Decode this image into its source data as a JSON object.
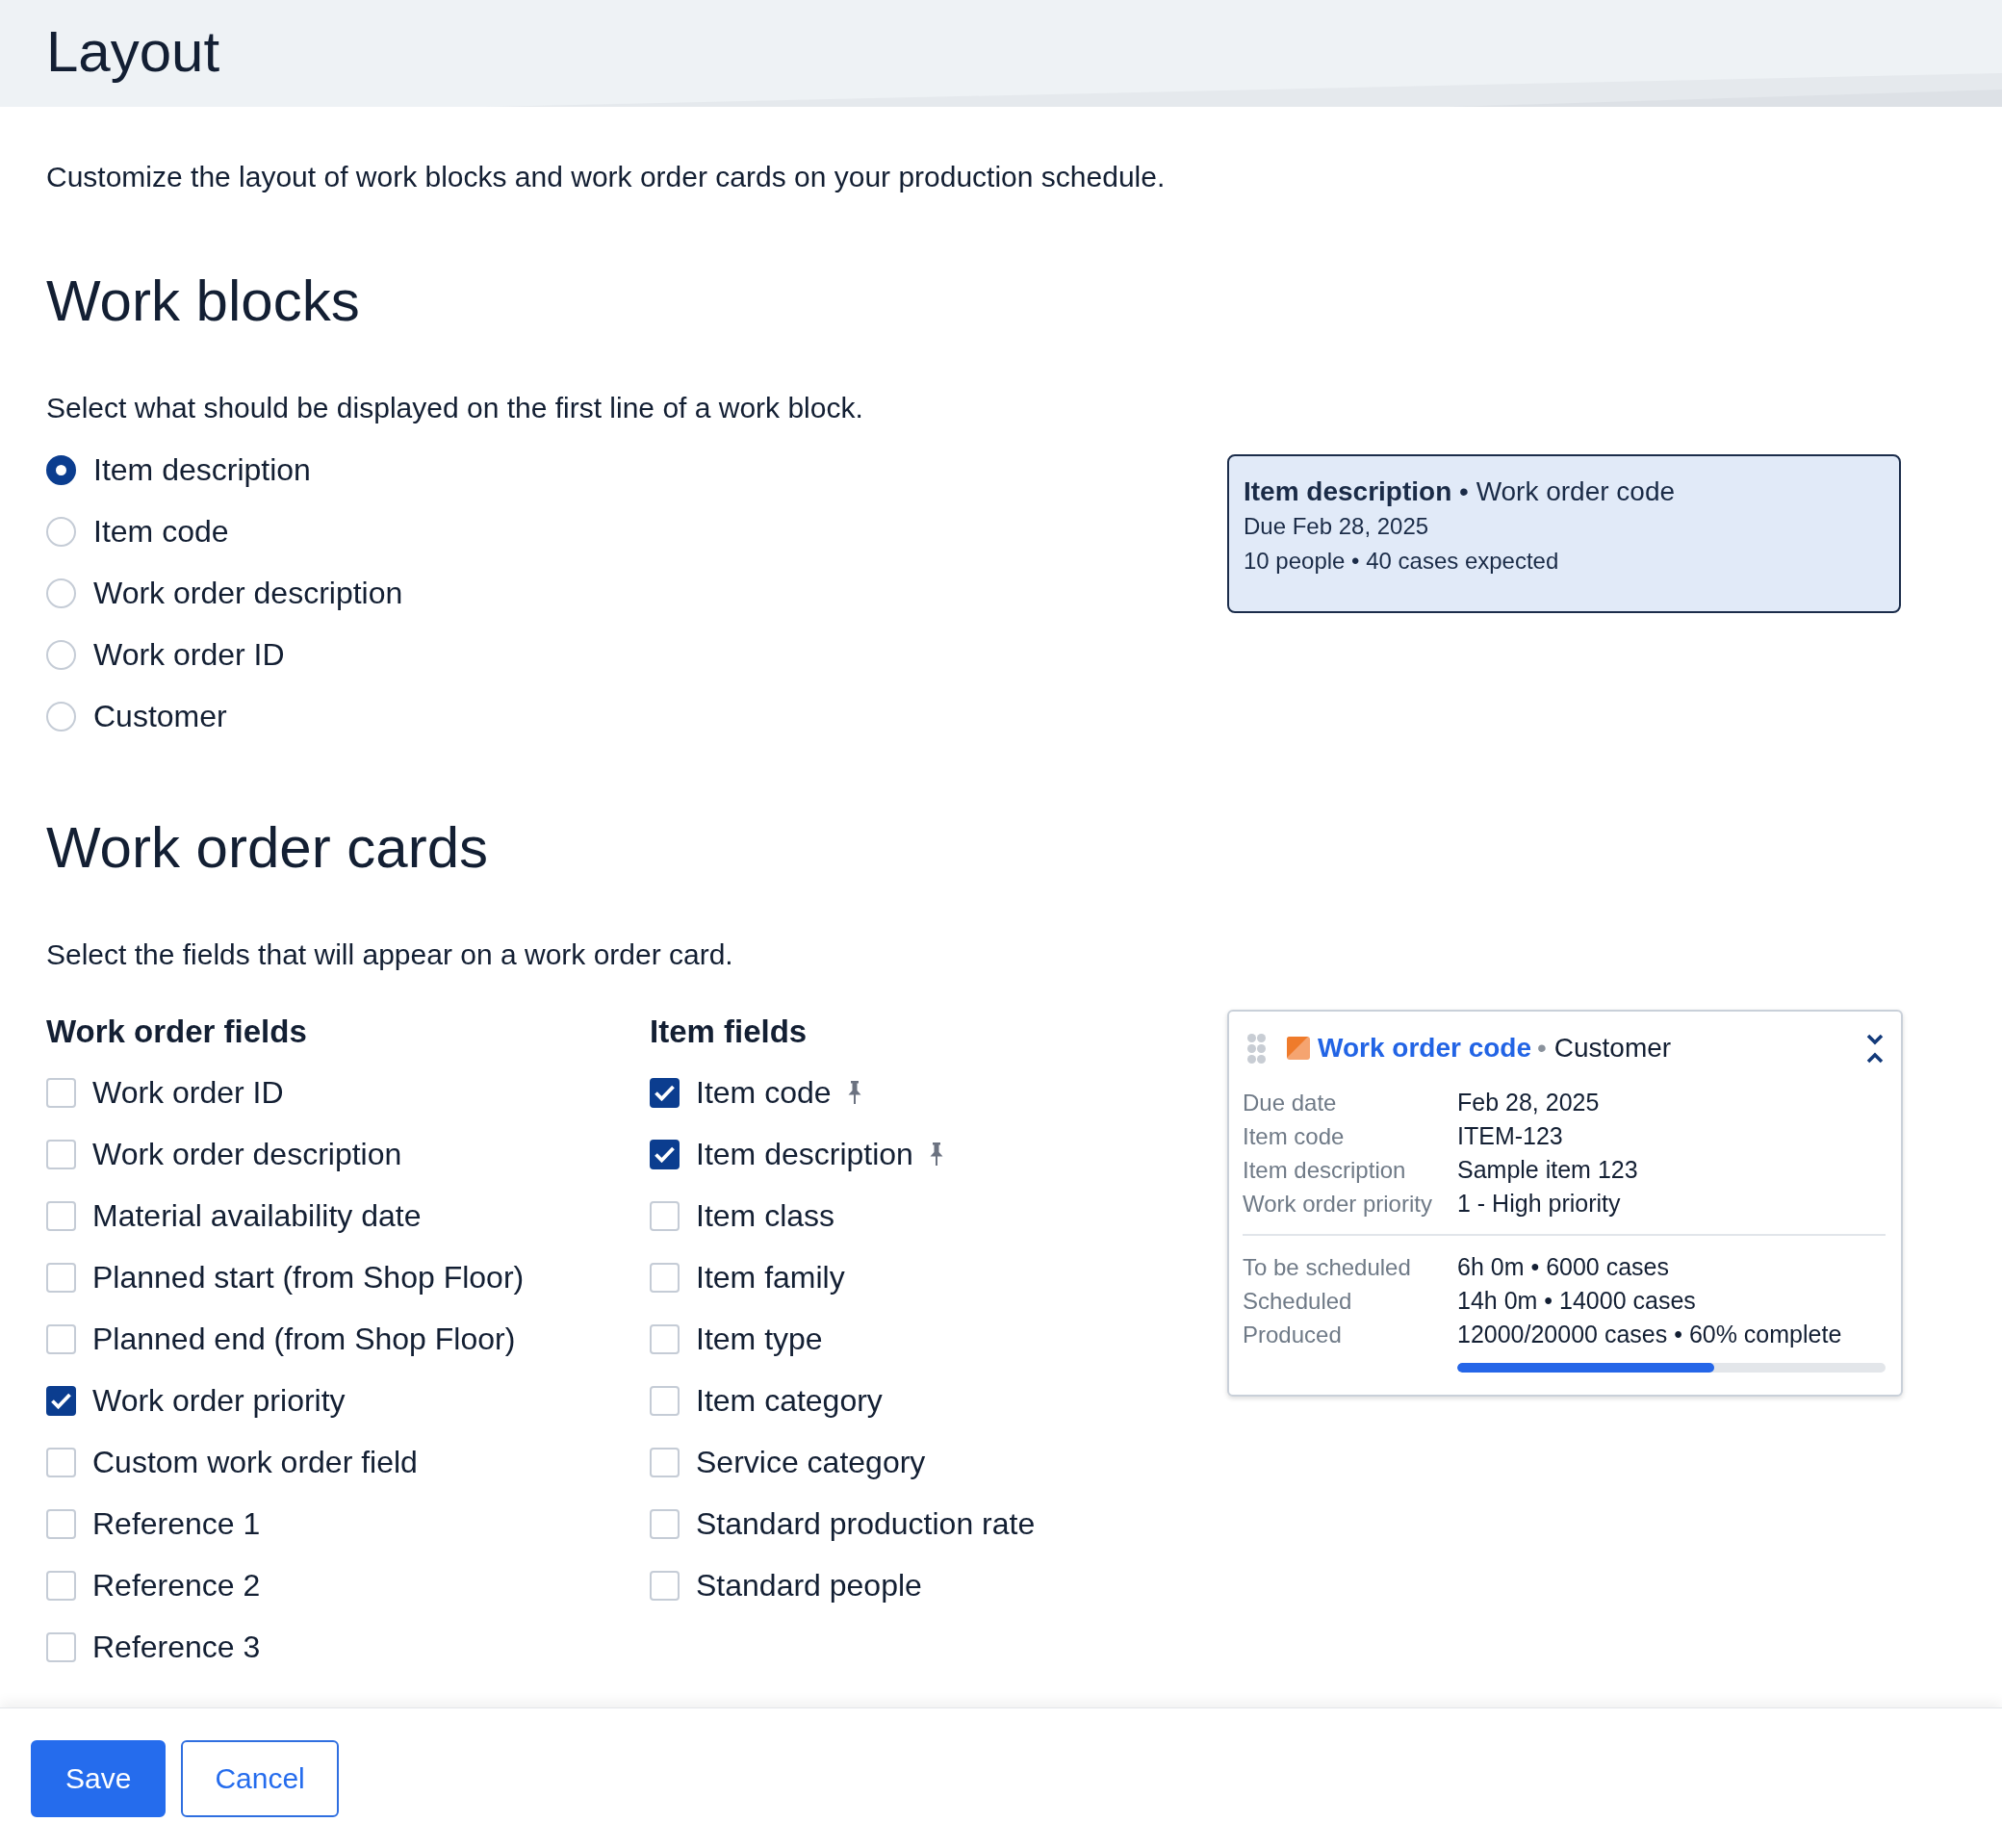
{
  "header": {
    "title": "Layout"
  },
  "intro": "Customize the layout of work blocks and work order cards on your production schedule.",
  "work_blocks": {
    "title": "Work blocks",
    "prompt": "Select what should be displayed on the first line of a work block.",
    "options": [
      {
        "label": "Item description",
        "selected": true
      },
      {
        "label": "Item code",
        "selected": false
      },
      {
        "label": "Work order description",
        "selected": false
      },
      {
        "label": "Work order ID",
        "selected": false
      },
      {
        "label": "Customer",
        "selected": false
      }
    ],
    "preview": {
      "title": "**Item description** • Work order code",
      "due": "Due Feb 28, 2025",
      "summary": "10 people • 40 cases expected"
    }
  },
  "work_order_cards": {
    "title": "Work order cards",
    "prompt": "Select the fields that will appear on a work order card.",
    "groups": [
      {
        "title": "Work order fields",
        "fields": [
          {
            "label": "Work order ID",
            "checked": false,
            "pinned": false
          },
          {
            "label": "Work order description",
            "checked": false,
            "pinned": false
          },
          {
            "label": "Material availability date",
            "checked": false,
            "pinned": false
          },
          {
            "label": "Planned start (from Shop Floor)",
            "checked": false,
            "pinned": false
          },
          {
            "label": "Planned end (from Shop Floor)",
            "checked": false,
            "pinned": false
          },
          {
            "label": "Work order priority",
            "checked": true,
            "pinned": false
          },
          {
            "label": "Custom work order field",
            "checked": false,
            "pinned": false
          },
          {
            "label": "Reference 1",
            "checked": false,
            "pinned": false
          },
          {
            "label": "Reference 2",
            "checked": false,
            "pinned": false
          },
          {
            "label": "Reference 3",
            "checked": false,
            "pinned": false
          }
        ]
      },
      {
        "title": "Item fields",
        "fields": [
          {
            "label": "Item code",
            "checked": true,
            "pinned": true
          },
          {
            "label": "Item description",
            "checked": true,
            "pinned": true
          },
          {
            "label": "Item class",
            "checked": false,
            "pinned": false
          },
          {
            "label": "Item family",
            "checked": false,
            "pinned": false
          },
          {
            "label": "Item type",
            "checked": false,
            "pinned": false
          },
          {
            "label": "Item category",
            "checked": false,
            "pinned": false
          },
          {
            "label": "Service category",
            "checked": false,
            "pinned": false
          },
          {
            "label": "Standard production rate",
            "checked": false,
            "pinned": false
          },
          {
            "label": "Standard people",
            "checked": false,
            "pinned": false
          }
        ]
      }
    ],
    "preview": {
      "title": "Work order code",
      "separator": "•",
      "subtitle": "Customer",
      "details": [
        {
          "label": "Due date",
          "value": "Feb 28, 2025"
        },
        {
          "label": "Item code",
          "value": "ITEM-123"
        },
        {
          "label": "Item description",
          "value": "Sample item 123"
        },
        {
          "label": "Work order priority",
          "value": "1 - High priority"
        }
      ],
      "schedule": [
        {
          "label": "To be scheduled",
          "value": "6h 0m • 6000 cases"
        },
        {
          "label": "Scheduled",
          "value": "14h 0m • 14000 cases"
        },
        {
          "label": "Produced",
          "value": "12000/20000 cases • 60% complete"
        }
      ],
      "progress": {
        "level": 0.6
      }
    }
  },
  "buttons": [
    {
      "label": "Save",
      "kind": "primary"
    },
    {
      "label": "Cancel",
      "kind": "secondary"
    }
  ]
}
